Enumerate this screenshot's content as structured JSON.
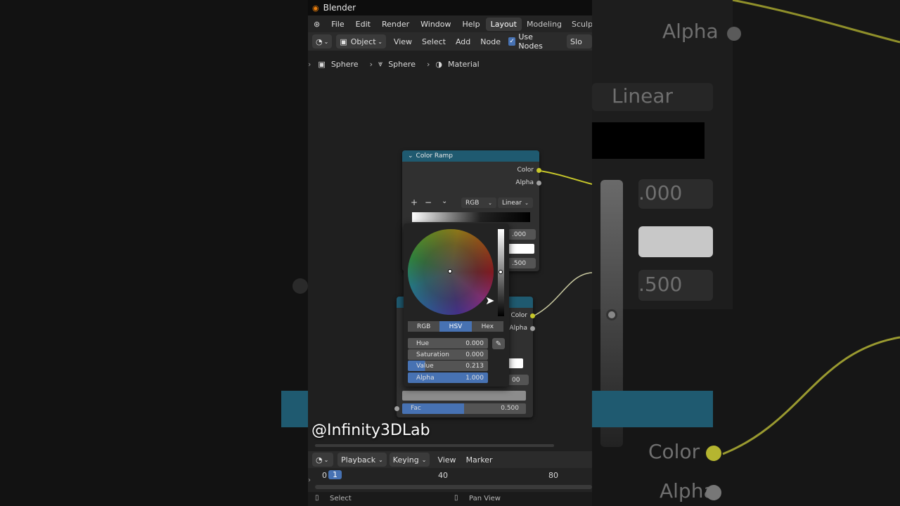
{
  "window": {
    "app_title": "Blender"
  },
  "menu": {
    "items": [
      "File",
      "Edit",
      "Render",
      "Window",
      "Help"
    ]
  },
  "workspace_tabs": [
    {
      "label": "Layout",
      "active": true
    },
    {
      "label": "Modeling",
      "active": false
    },
    {
      "label": "Sculpting",
      "active": false
    }
  ],
  "header": {
    "mode_label": "Object",
    "menus": [
      "View",
      "Select",
      "Add",
      "Node"
    ],
    "use_nodes_label": "Use Nodes",
    "use_nodes_checked": true,
    "slot_label": "Slo"
  },
  "breadcrumb": {
    "object": "Sphere",
    "mesh": "Sphere",
    "material": "Material"
  },
  "color_ramp_node": {
    "title": "Color Ramp",
    "outputs": [
      "Color",
      "Alpha"
    ],
    "plus": "+",
    "minus": "−",
    "color_mode": "RGB",
    "interpolation": "Linear",
    "pos_value": ".000",
    "fac_value": ".500"
  },
  "second_node": {
    "outputs": [
      "Color",
      "Alpha"
    ],
    "partial_value": "00",
    "fac_label": "Fac",
    "fac_value": "0.500",
    "fac_fraction": 0.5
  },
  "color_picker": {
    "modes": [
      {
        "label": "RGB",
        "active": false
      },
      {
        "label": "HSV",
        "active": true
      },
      {
        "label": "Hex",
        "active": false
      }
    ],
    "fields": [
      {
        "label": "Hue",
        "value": "0.000",
        "fill": 0.0
      },
      {
        "label": "Saturation",
        "value": "0.000",
        "fill": 0.0
      },
      {
        "label": "Value",
        "value": "0.213",
        "fill": 0.213
      },
      {
        "label": "Alpha",
        "value": "1.000",
        "fill": 1.0
      }
    ],
    "eyedropper_icon": "eyedropper-icon"
  },
  "timeline": {
    "menus": [
      "Playback",
      "Keying",
      "View",
      "Marker"
    ],
    "current_frame": "1",
    "ruler_ticks": [
      "0",
      "40",
      "80"
    ]
  },
  "statusbar": {
    "left": "Select",
    "right": "Pan View"
  },
  "background_zoom": {
    "alpha": "Alpha",
    "linear": "Linear",
    "v1": ".000",
    "v2": ".500",
    "color": "Color",
    "alpha2": "Alpha"
  },
  "watermark": "@Infinity3DLab",
  "colors": {
    "accent_blue": "#4772b3",
    "node_header": "#1f5a70",
    "socket_yellow": "#c7c72a",
    "socket_grey": "#a0a0a0"
  }
}
